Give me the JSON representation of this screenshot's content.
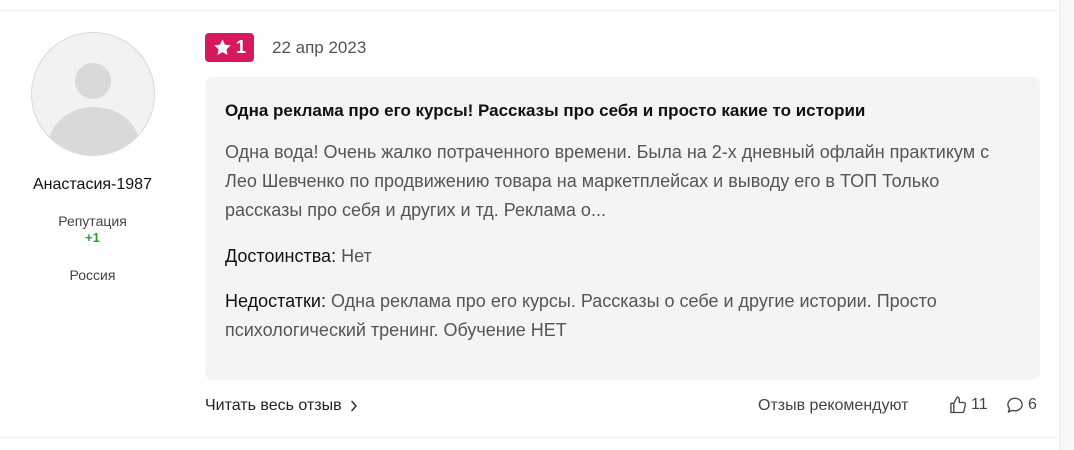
{
  "user": {
    "name": "Анастасия-1987",
    "reputation_label": "Репутация",
    "reputation_value": "+1",
    "country": "Россия"
  },
  "review": {
    "rating": "1",
    "date": "22 апр 2023",
    "title": "Одна реклама про его курсы! Рассказы про себя и просто какие то истории",
    "text": "Одна вода! Очень жалко потраченного времени. Была на 2-х дневный офлайн практикум с Лео Шевченко по продвижению товара на маркетплейсах и выводу его в ТОП Только рассказы про себя и других и тд. Реклама о...",
    "pros_label": "Достоинства:",
    "pros_value": "Нет",
    "cons_label": "Недостатки:",
    "cons_value": "Одна реклама про его курсы. Рассказы о себе и другие истории. Просто психологический тренинг. Обучение НЕТ"
  },
  "footer": {
    "read_more": "Читать весь отзыв",
    "recommend_label": "Отзыв рекомендуют",
    "likes": "11",
    "comments": "6"
  },
  "colors": {
    "badge": "#d6195c",
    "reputation_positive": "#2a9d3a",
    "card_background": "#f4f4f5"
  },
  "icons": [
    "avatar-placeholder",
    "star-icon",
    "chevron-right-icon",
    "thumbs-up-icon",
    "comment-icon"
  ]
}
